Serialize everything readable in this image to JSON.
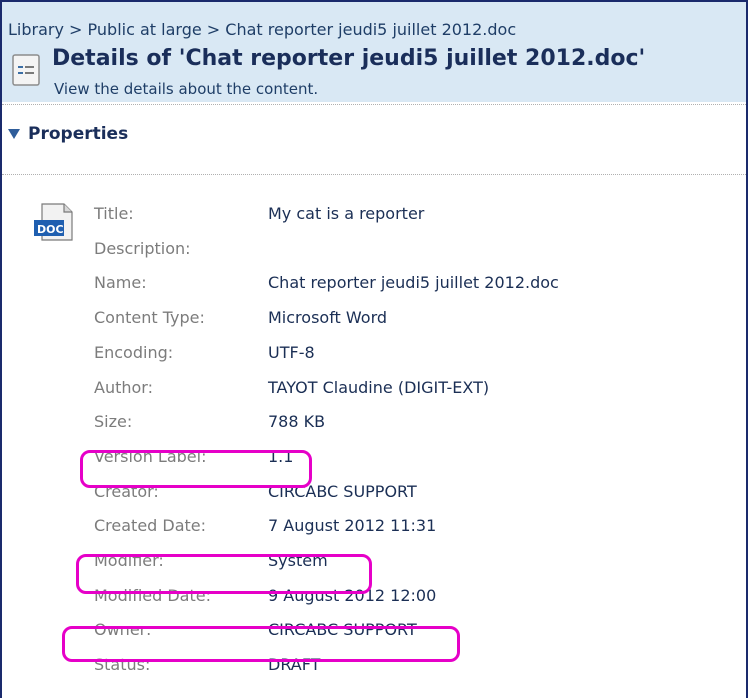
{
  "breadcrumb": {
    "items": [
      "Library",
      "Public at large",
      "Chat reporter jeudi5 juillet 2012.doc"
    ],
    "separator": ">"
  },
  "header": {
    "title": "Details of 'Chat reporter jeudi5 juillet 2012.doc'",
    "subtitle": "View the details about the content."
  },
  "properties": {
    "heading": "Properties",
    "rows": [
      {
        "label": "Title:",
        "value": "My cat is a reporter"
      },
      {
        "label": "Description:",
        "value": ""
      },
      {
        "label": "Name:",
        "value": "Chat reporter jeudi5 juillet 2012.doc"
      },
      {
        "label": "Content Type:",
        "value": "Microsoft Word"
      },
      {
        "label": "Encoding:",
        "value": "UTF-8"
      },
      {
        "label": "Author:",
        "value": "TAYOT Claudine (DIGIT-EXT)"
      },
      {
        "label": "Size:",
        "value": "788 KB"
      },
      {
        "label": "Version Label:",
        "value": "1.1"
      },
      {
        "label": "Creator:",
        "value": "CIRCABC SUPPORT"
      },
      {
        "label": "Created Date:",
        "value": "7 August 2012 11:31"
      },
      {
        "label": "Modifier:",
        "value": "System"
      },
      {
        "label": "Modified Date:",
        "value": "9 August 2012 12:00"
      },
      {
        "label": "Owner:",
        "value": "CIRCABC SUPPORT"
      },
      {
        "label": "Status:",
        "value": "DRAFT"
      }
    ]
  },
  "icons": {
    "header_icon": "document-details-icon",
    "file_icon": "doc-file-icon",
    "expand_icon": "triangle-down-icon"
  },
  "colors": {
    "header_bg": "#d9e8f4",
    "highlight": "#e600c8",
    "label": "#7c7c7c",
    "value": "#1b2f55"
  }
}
